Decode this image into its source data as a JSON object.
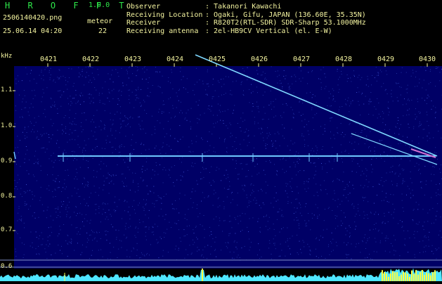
{
  "header": {
    "app_title": "H R O F F T",
    "app_version": "1.0.0",
    "file_name": "2506140420.png",
    "datetime": "25.06.14 04:20",
    "meteor_label": "meteor",
    "meteor_count": "22",
    "info": [
      {
        "key": "Observer",
        "value": ": Takanori Kawachi"
      },
      {
        "key": "Receiving Location",
        "value": ": Ogaki, Gifu, JAPAN (136.60E, 35.35N)"
      },
      {
        "key": "Receiver",
        "value": ": R820T2(RTL-SDR) SDR-Sharp 53.1000MHz"
      },
      {
        "key": "Receiving antenna",
        "value": ": 2el-HB9CV Vertical (el. E-W)"
      }
    ]
  },
  "plot": {
    "unit_label": "kHz",
    "time_labels": [
      "0421",
      "0422",
      "0423",
      "0424",
      "0425",
      "0426",
      "0427",
      "0428",
      "0429",
      "0430"
    ],
    "freq_labels": [
      "1.1",
      "1.0",
      "0.9",
      "0.8",
      "0.7",
      "0.6"
    ],
    "bottom_label": "0.6",
    "colors": {
      "background": "#000066",
      "noise": "#1f2fa0",
      "trace": "#7fd8ff",
      "carrier": "#6ec8ff",
      "tick": "#f4f4a0",
      "spectrum": "#4fe6ff",
      "spectrum_peak": "#ffff40"
    }
  }
}
